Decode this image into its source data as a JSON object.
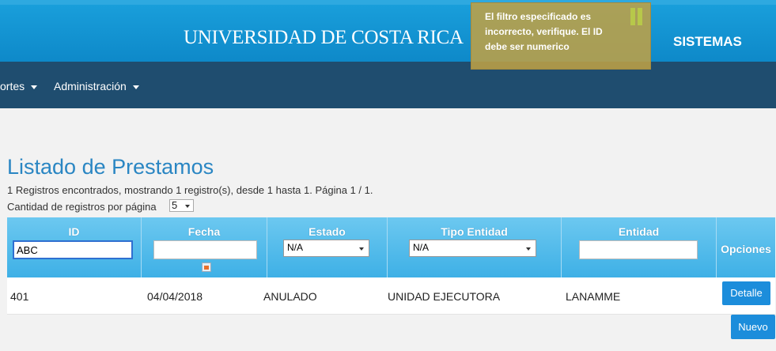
{
  "header": {
    "university": "UNIVERSIDAD DE COSTA RICA",
    "system": "SISTEMAS"
  },
  "nav": {
    "items": [
      {
        "label": "ortes"
      },
      {
        "label": "Administración"
      }
    ]
  },
  "alert": {
    "message": "El filtro especificado es incorrecto, verifique. El ID debe ser numerico"
  },
  "page": {
    "title": "Listado de Prestamos",
    "summary": "1 Registros encontrados, mostrando 1 registro(s), desde 1 hasta 1. Página 1 / 1.",
    "per_page_label": "Cantidad de registros por página",
    "per_page_value": "5"
  },
  "table": {
    "columns": [
      "ID",
      "Fecha",
      "Estado",
      "Tipo Entidad",
      "Entidad",
      "Opciones"
    ],
    "filters": {
      "id": "ABC",
      "fecha": "",
      "estado": "N/A",
      "tipo_entidad": "N/A",
      "entidad": ""
    },
    "rows": [
      {
        "id": "401",
        "fecha": "04/04/2018",
        "estado": "ANULADO",
        "tipo_entidad": "UNIDAD EJECUTORA",
        "entidad": "LANAMME",
        "action": "Detalle"
      }
    ]
  },
  "new_button": "Nuevo"
}
